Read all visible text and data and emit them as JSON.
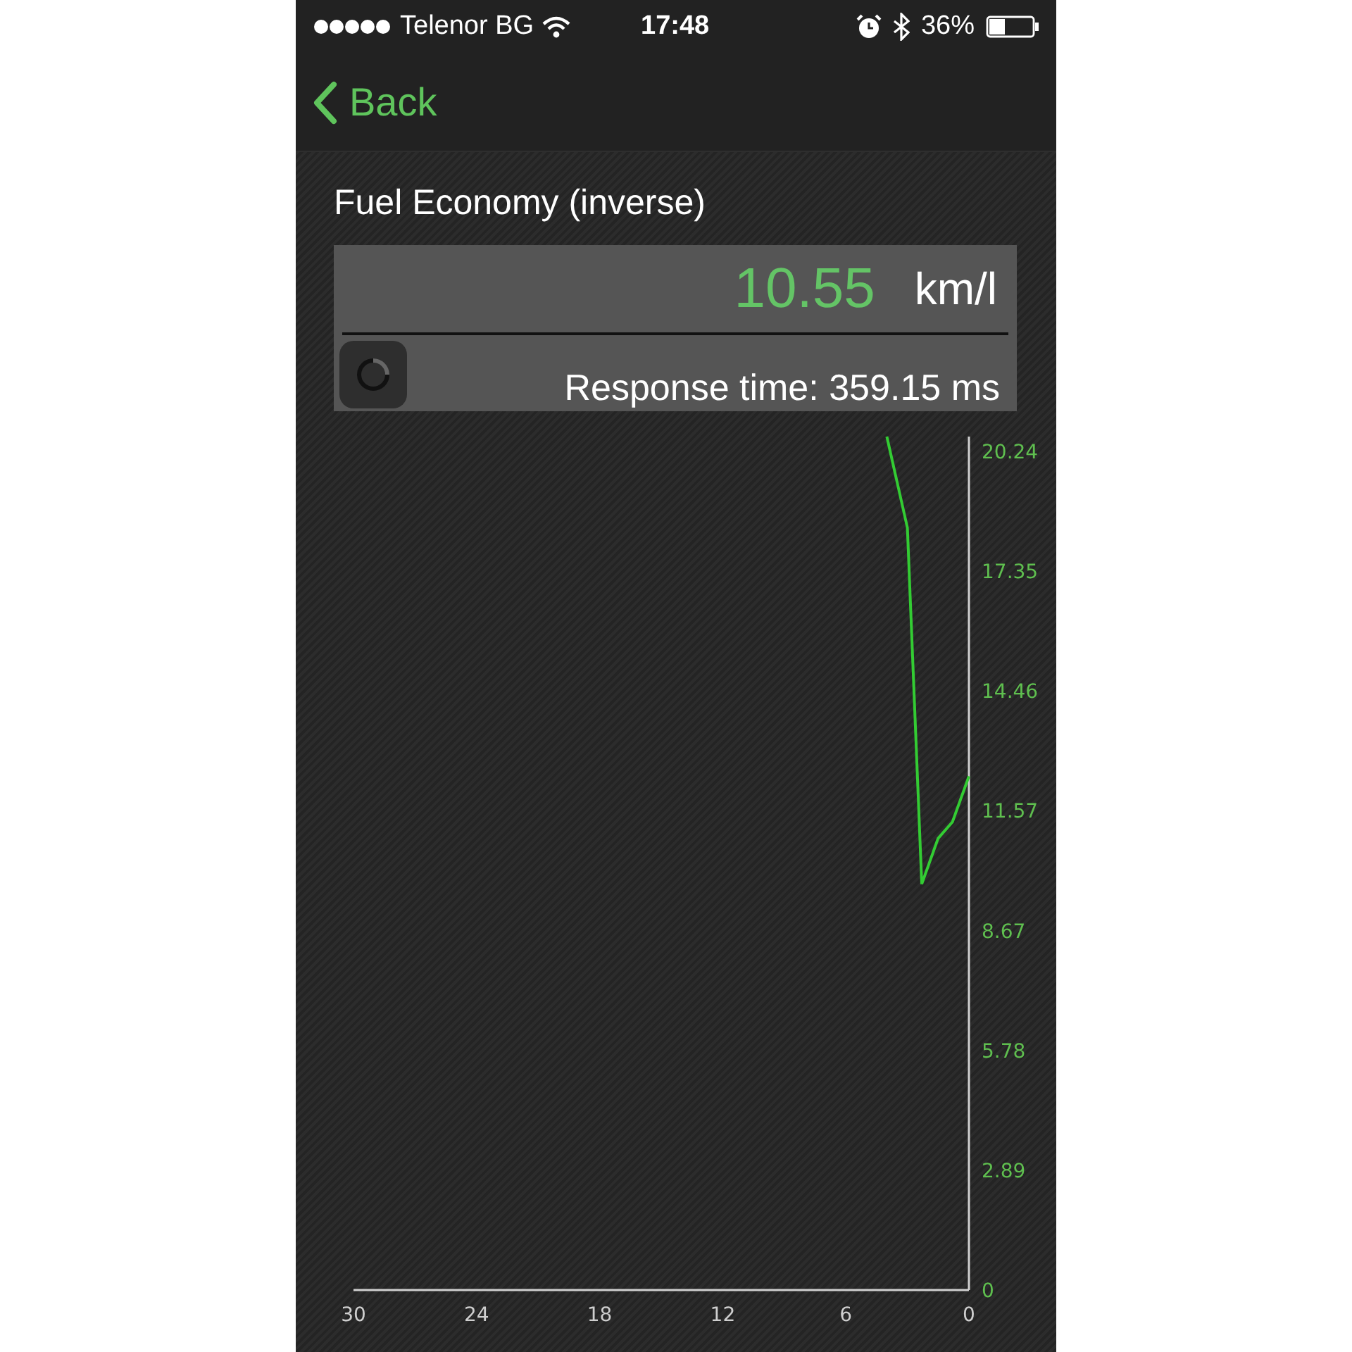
{
  "status_bar": {
    "carrier": "Telenor BG",
    "time": "17:48",
    "battery": "36%"
  },
  "nav": {
    "back": "Back"
  },
  "title": "Fuel Economy (inverse)",
  "reading": {
    "value": "10.55",
    "unit": "km/l",
    "response": "Response time: 359.15 ms"
  },
  "chart_data": {
    "type": "line",
    "xlim": [
      30,
      0
    ],
    "ylim": [
      0,
      20.6
    ],
    "xticks": [
      30,
      24,
      18,
      12,
      6,
      0
    ],
    "yticks": [
      20.24,
      17.35,
      14.46,
      11.57,
      8.67,
      5.78,
      2.89,
      0
    ],
    "x": [
      4,
      3,
      2.3,
      1.5,
      0.8,
      0
    ],
    "series": [
      {
        "color": "#33cc33",
        "values": [
          20.6,
          18.4,
          9.8,
          10.9,
          11.3,
          12.4
        ]
      }
    ]
  }
}
